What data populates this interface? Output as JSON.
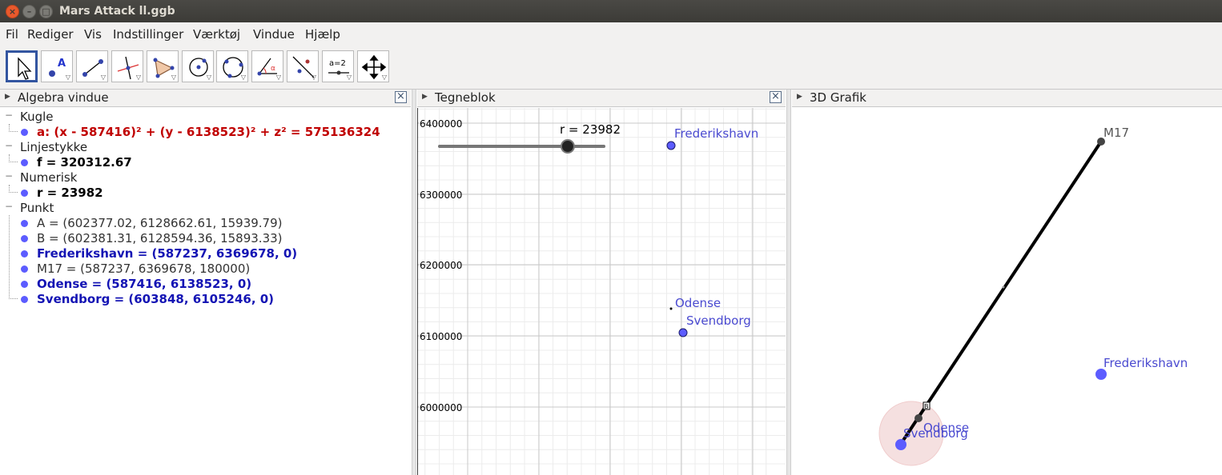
{
  "window": {
    "title": "Mars Attack ll.ggb"
  },
  "menu": [
    "Fil",
    "Rediger",
    "Vis",
    "Indstillinger",
    "Værktøj",
    "Vindue",
    "Hjælp"
  ],
  "toolbar": {
    "tools": [
      "move-tool",
      "point-tool",
      "line-tool",
      "perpendicular-line-tool",
      "polygon-tool",
      "circle-center-tool",
      "circle-three-points-tool",
      "angle-tool",
      "reflect-tool",
      "slider-tool",
      "move-graphics-tool"
    ],
    "slider_label": "a=2"
  },
  "algebra": {
    "title": "Algebra vindue",
    "categories": [
      {
        "name": "Kugle",
        "items": [
          {
            "text": "a: (x - 587416)² + (y - 6138523)² + z² = 575136324",
            "color": "#c00000"
          }
        ]
      },
      {
        "name": "Linjestykke",
        "items": [
          {
            "text": "f = 320312.67",
            "color": "#000000"
          }
        ]
      },
      {
        "name": "Numerisk",
        "items": [
          {
            "text": "r = 23982",
            "color": "#000000"
          }
        ]
      },
      {
        "name": "Punkt",
        "items": [
          {
            "text": "A = (602377.02, 6128662.61, 15939.79)",
            "color": "#333333"
          },
          {
            "text": "B = (602381.31, 6128594.36, 15893.33)",
            "color": "#333333"
          },
          {
            "text": "Frederikshavn = (587237, 6369678, 0)",
            "color": "#1414b4"
          },
          {
            "text": "M17 = (587237, 6369678, 180000)",
            "color": "#333333"
          },
          {
            "text": "Odense = (587416, 6138523, 0)",
            "color": "#1414b4"
          },
          {
            "text": "Svendborg = (603848, 6105246, 0)",
            "color": "#1414b4"
          }
        ]
      }
    ]
  },
  "graphics": {
    "title": "Tegneblok",
    "y_ticks": [
      "6400000",
      "6300000",
      "6200000",
      "6100000",
      "6000000"
    ],
    "slider": {
      "label": "r = 23982",
      "value": 0.78
    },
    "points": {
      "frederikshavn": "Frederikshavn",
      "odense": "Odense",
      "svendborg": "Svendborg"
    }
  },
  "view3d": {
    "title": "3D Grafik",
    "labels": {
      "m17": "M17",
      "frederikshavn": "Frederikshavn",
      "odense": "Odense",
      "svendborg": "Svendborg",
      "b": "B"
    }
  },
  "colors": {
    "point": "#5c5cff",
    "accent": "#3355a0",
    "sphere": "#f5d6d6"
  }
}
